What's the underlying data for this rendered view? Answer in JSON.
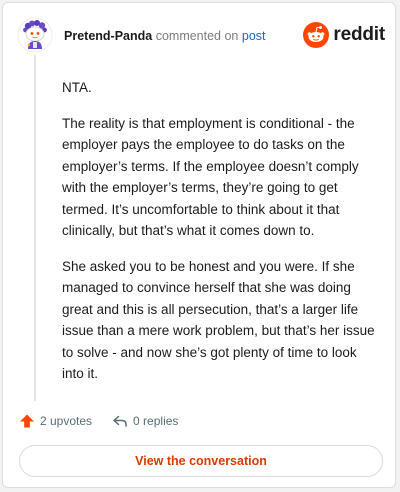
{
  "header": {
    "author": "Pretend-Panda",
    "commented_on": "commented on",
    "post_link": "post",
    "brand_word": "reddit",
    "avatar_icon": "snoo-avatar-icon",
    "brand_icon": "reddit-snoo-logo-icon"
  },
  "comment": {
    "paragraphs": [
      "NTA.",
      "The reality is that employment is conditional - the employer pays the employee to do tasks on the employer’s terms. If the employee doesn’t comply with the employer’s terms, they’re going to get termed. It’s uncomfortable to think about it that clinically, but that’s what it comes down to.",
      "She asked you to be honest and you were. If she managed to convince herself that she was doing great and this is all persecution, that’s a larger life issue than a mere work problem, but that’s her issue to solve - and now she’s got plenty of time to look into it."
    ]
  },
  "actions": {
    "upvotes": "2 upvotes",
    "replies": "0 replies",
    "upvote_icon": "upvote-arrow-icon",
    "reply_icon": "reply-arrow-icon"
  },
  "view_button": "View the conversation",
  "colors": {
    "brand": "#ff4500",
    "link": "#1f66c2",
    "button_text": "#d93a00",
    "meta_text": "#576f76"
  }
}
